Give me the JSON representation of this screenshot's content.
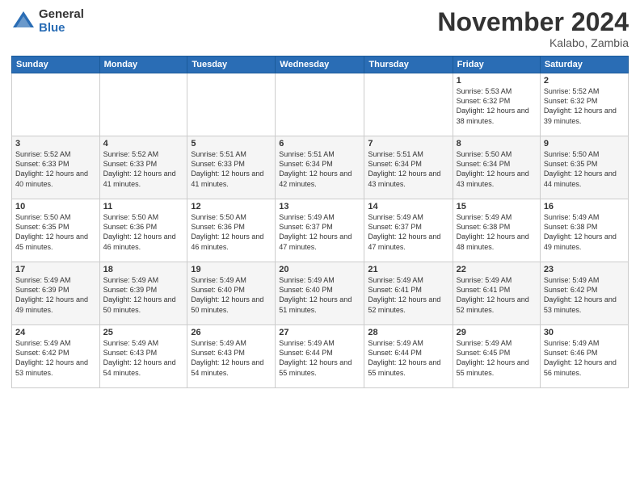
{
  "logo": {
    "general": "General",
    "blue": "Blue"
  },
  "header": {
    "month": "November 2024",
    "location": "Kalabo, Zambia"
  },
  "weekdays": [
    "Sunday",
    "Monday",
    "Tuesday",
    "Wednesday",
    "Thursday",
    "Friday",
    "Saturday"
  ],
  "weeks": [
    [
      {
        "day": "",
        "info": ""
      },
      {
        "day": "",
        "info": ""
      },
      {
        "day": "",
        "info": ""
      },
      {
        "day": "",
        "info": ""
      },
      {
        "day": "",
        "info": ""
      },
      {
        "day": "1",
        "info": "Sunrise: 5:53 AM\nSunset: 6:32 PM\nDaylight: 12 hours and 38 minutes."
      },
      {
        "day": "2",
        "info": "Sunrise: 5:52 AM\nSunset: 6:32 PM\nDaylight: 12 hours and 39 minutes."
      }
    ],
    [
      {
        "day": "3",
        "info": "Sunrise: 5:52 AM\nSunset: 6:33 PM\nDaylight: 12 hours and 40 minutes."
      },
      {
        "day": "4",
        "info": "Sunrise: 5:52 AM\nSunset: 6:33 PM\nDaylight: 12 hours and 41 minutes."
      },
      {
        "day": "5",
        "info": "Sunrise: 5:51 AM\nSunset: 6:33 PM\nDaylight: 12 hours and 41 minutes."
      },
      {
        "day": "6",
        "info": "Sunrise: 5:51 AM\nSunset: 6:34 PM\nDaylight: 12 hours and 42 minutes."
      },
      {
        "day": "7",
        "info": "Sunrise: 5:51 AM\nSunset: 6:34 PM\nDaylight: 12 hours and 43 minutes."
      },
      {
        "day": "8",
        "info": "Sunrise: 5:50 AM\nSunset: 6:34 PM\nDaylight: 12 hours and 43 minutes."
      },
      {
        "day": "9",
        "info": "Sunrise: 5:50 AM\nSunset: 6:35 PM\nDaylight: 12 hours and 44 minutes."
      }
    ],
    [
      {
        "day": "10",
        "info": "Sunrise: 5:50 AM\nSunset: 6:35 PM\nDaylight: 12 hours and 45 minutes."
      },
      {
        "day": "11",
        "info": "Sunrise: 5:50 AM\nSunset: 6:36 PM\nDaylight: 12 hours and 46 minutes."
      },
      {
        "day": "12",
        "info": "Sunrise: 5:50 AM\nSunset: 6:36 PM\nDaylight: 12 hours and 46 minutes."
      },
      {
        "day": "13",
        "info": "Sunrise: 5:49 AM\nSunset: 6:37 PM\nDaylight: 12 hours and 47 minutes."
      },
      {
        "day": "14",
        "info": "Sunrise: 5:49 AM\nSunset: 6:37 PM\nDaylight: 12 hours and 47 minutes."
      },
      {
        "day": "15",
        "info": "Sunrise: 5:49 AM\nSunset: 6:38 PM\nDaylight: 12 hours and 48 minutes."
      },
      {
        "day": "16",
        "info": "Sunrise: 5:49 AM\nSunset: 6:38 PM\nDaylight: 12 hours and 49 minutes."
      }
    ],
    [
      {
        "day": "17",
        "info": "Sunrise: 5:49 AM\nSunset: 6:39 PM\nDaylight: 12 hours and 49 minutes."
      },
      {
        "day": "18",
        "info": "Sunrise: 5:49 AM\nSunset: 6:39 PM\nDaylight: 12 hours and 50 minutes."
      },
      {
        "day": "19",
        "info": "Sunrise: 5:49 AM\nSunset: 6:40 PM\nDaylight: 12 hours and 50 minutes."
      },
      {
        "day": "20",
        "info": "Sunrise: 5:49 AM\nSunset: 6:40 PM\nDaylight: 12 hours and 51 minutes."
      },
      {
        "day": "21",
        "info": "Sunrise: 5:49 AM\nSunset: 6:41 PM\nDaylight: 12 hours and 52 minutes."
      },
      {
        "day": "22",
        "info": "Sunrise: 5:49 AM\nSunset: 6:41 PM\nDaylight: 12 hours and 52 minutes."
      },
      {
        "day": "23",
        "info": "Sunrise: 5:49 AM\nSunset: 6:42 PM\nDaylight: 12 hours and 53 minutes."
      }
    ],
    [
      {
        "day": "24",
        "info": "Sunrise: 5:49 AM\nSunset: 6:42 PM\nDaylight: 12 hours and 53 minutes."
      },
      {
        "day": "25",
        "info": "Sunrise: 5:49 AM\nSunset: 6:43 PM\nDaylight: 12 hours and 54 minutes."
      },
      {
        "day": "26",
        "info": "Sunrise: 5:49 AM\nSunset: 6:43 PM\nDaylight: 12 hours and 54 minutes."
      },
      {
        "day": "27",
        "info": "Sunrise: 5:49 AM\nSunset: 6:44 PM\nDaylight: 12 hours and 55 minutes."
      },
      {
        "day": "28",
        "info": "Sunrise: 5:49 AM\nSunset: 6:44 PM\nDaylight: 12 hours and 55 minutes."
      },
      {
        "day": "29",
        "info": "Sunrise: 5:49 AM\nSunset: 6:45 PM\nDaylight: 12 hours and 55 minutes."
      },
      {
        "day": "30",
        "info": "Sunrise: 5:49 AM\nSunset: 6:46 PM\nDaylight: 12 hours and 56 minutes."
      }
    ]
  ]
}
